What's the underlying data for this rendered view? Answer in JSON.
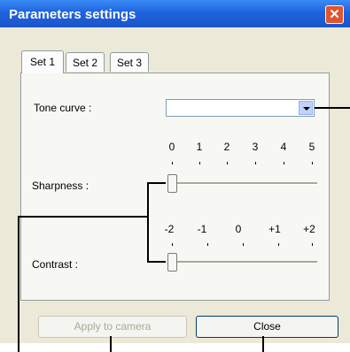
{
  "window": {
    "title": "Parameters settings"
  },
  "tabs": [
    {
      "label": "Set 1",
      "active": true
    },
    {
      "label": "Set 2",
      "active": false
    },
    {
      "label": "Set 3",
      "active": false
    }
  ],
  "tone_curve": {
    "label": "Tone curve :",
    "value": ""
  },
  "sharpness": {
    "label": "Sharpness :",
    "scale": [
      "0",
      "1",
      "2",
      "3",
      "4",
      "5"
    ],
    "value": "0"
  },
  "contrast": {
    "label": "Contrast :",
    "scale": [
      "-2",
      "-1",
      "0",
      "+1",
      "+2"
    ],
    "value": "-2"
  },
  "buttons": {
    "apply_label": "Apply to camera",
    "close_label": "Close"
  }
}
